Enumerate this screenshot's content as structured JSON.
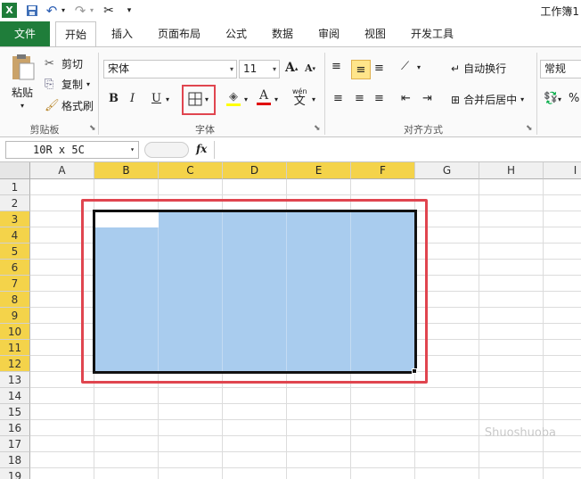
{
  "title_bar": {
    "workbook_title": "工作簿1"
  },
  "tabs": [
    {
      "label": "文件"
    },
    {
      "label": "开始"
    },
    {
      "label": "插入"
    },
    {
      "label": "页面布局"
    },
    {
      "label": "公式"
    },
    {
      "label": "数据"
    },
    {
      "label": "审阅"
    },
    {
      "label": "视图"
    },
    {
      "label": "开发工具"
    }
  ],
  "clipboard": {
    "paste": "粘贴",
    "cut": "剪切",
    "copy": "复制",
    "format_painter": "格式刷",
    "group_label": "剪贴板"
  },
  "font": {
    "name": "宋体",
    "size": "11",
    "bold": "B",
    "italic": "I",
    "underline": "U",
    "group_label": "字体",
    "wen": "wén",
    "wen_char": "文"
  },
  "alignment": {
    "wrap_text": "自动换行",
    "merge_center": "合并后居中",
    "group_label": "对齐方式"
  },
  "number": {
    "format": "常规",
    "percent": "%"
  },
  "formula_bar": {
    "name_box": "10R x 5C",
    "fx": "fx"
  },
  "columns": [
    "A",
    "B",
    "C",
    "D",
    "E",
    "F",
    "G",
    "H",
    "I"
  ],
  "rows": [
    "1",
    "2",
    "3",
    "4",
    "5",
    "6",
    "7",
    "8",
    "9",
    "10",
    "11",
    "12",
    "13",
    "14",
    "15",
    "16",
    "17",
    "18",
    "19"
  ],
  "watermark": "Shuoshuoba"
}
